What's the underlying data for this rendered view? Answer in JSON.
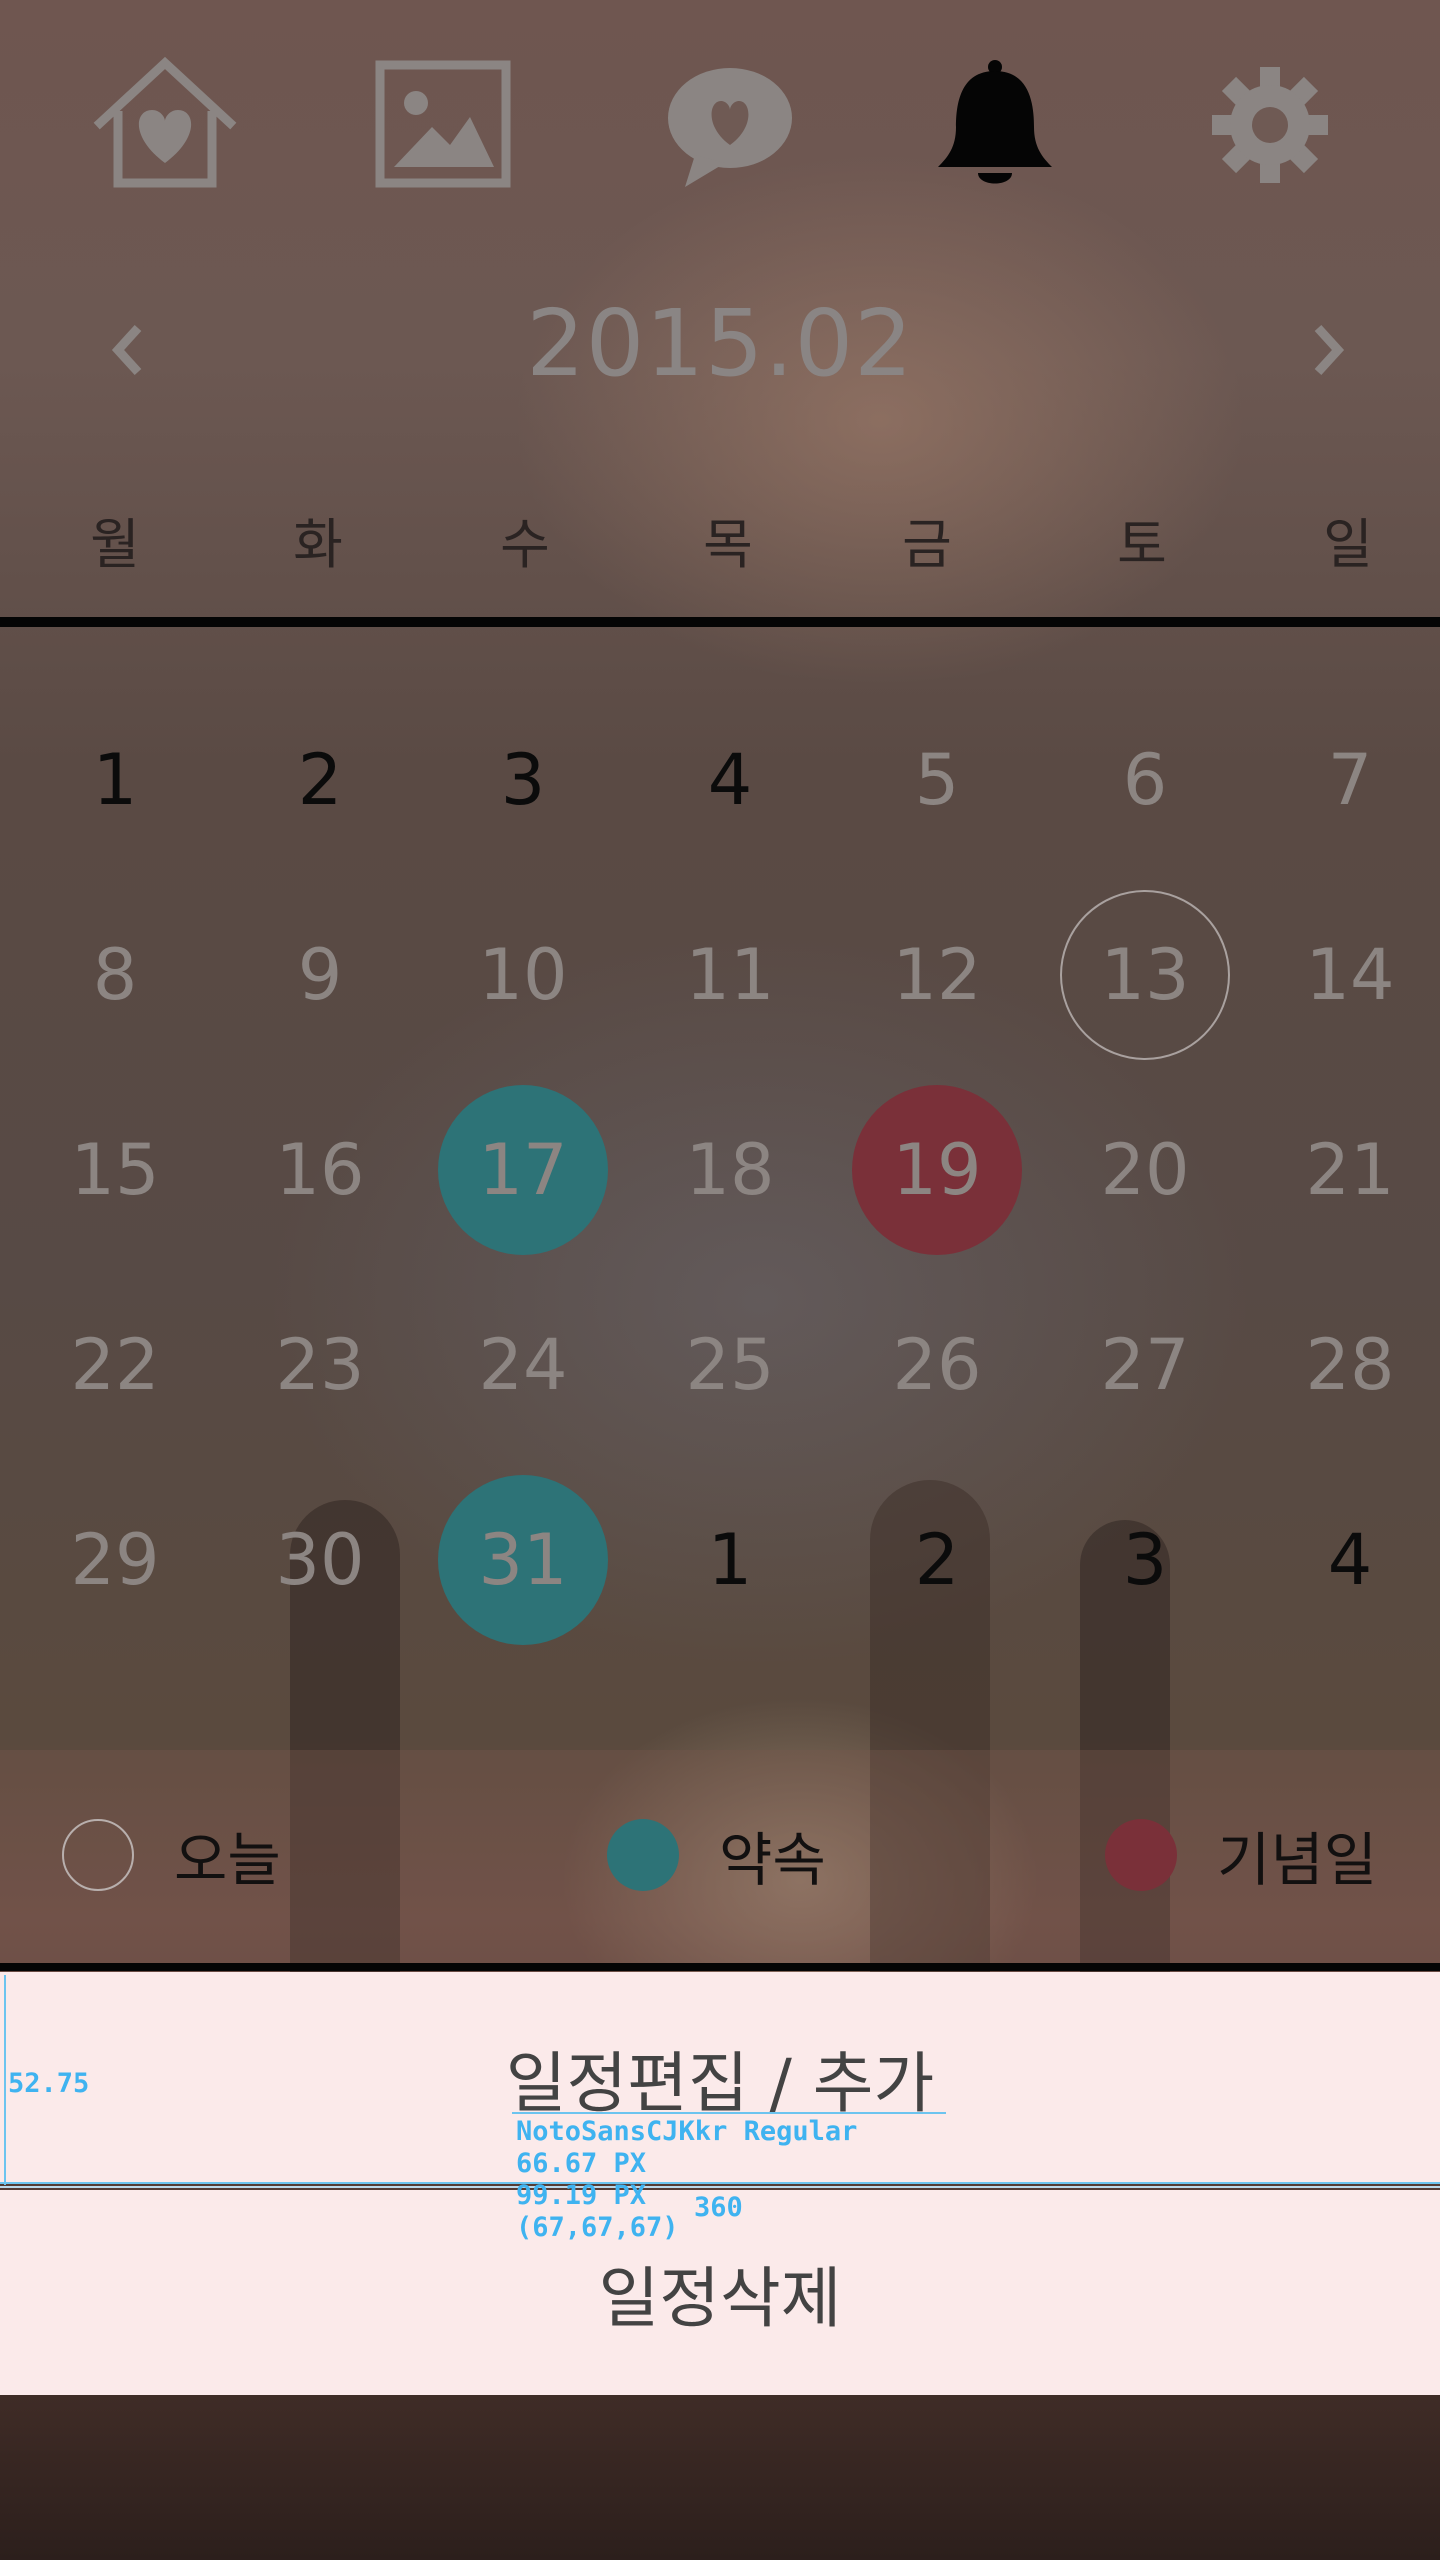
{
  "colors": {
    "appointment": "#2d7377",
    "anniversary": "#7a3039",
    "today_ring": "#a9a19f",
    "button_bg": "#fbeaea",
    "button_text": "#434343",
    "annotation": "#3fb3f0"
  },
  "nav": {
    "icons": [
      {
        "name": "home-heart-icon",
        "active": false
      },
      {
        "name": "image-icon",
        "active": false
      },
      {
        "name": "chat-heart-icon",
        "active": false
      },
      {
        "name": "bell-icon",
        "active": true
      },
      {
        "name": "gear-icon",
        "active": false
      }
    ]
  },
  "header": {
    "month": "2015.02",
    "prev_icon": "chevron-left-icon",
    "next_icon": "chevron-right-icon"
  },
  "weekdays": [
    "월",
    "화",
    "수",
    "목",
    "금",
    "토",
    "일"
  ],
  "calendar": {
    "weeks": [
      [
        {
          "d": "1",
          "style": "dark"
        },
        {
          "d": "2",
          "style": "dark"
        },
        {
          "d": "3",
          "style": "dark"
        },
        {
          "d": "4",
          "style": "dark"
        },
        {
          "d": "5",
          "style": "muted"
        },
        {
          "d": "6",
          "style": "muted"
        },
        {
          "d": "7",
          "style": "muted"
        }
      ],
      [
        {
          "d": "8",
          "style": "muted"
        },
        {
          "d": "9",
          "style": "muted"
        },
        {
          "d": "10",
          "style": "muted"
        },
        {
          "d": "11",
          "style": "muted"
        },
        {
          "d": "12",
          "style": "muted"
        },
        {
          "d": "13",
          "style": "today"
        },
        {
          "d": "14",
          "style": "muted"
        }
      ],
      [
        {
          "d": "15",
          "style": "muted"
        },
        {
          "d": "16",
          "style": "muted"
        },
        {
          "d": "17",
          "style": "appointment"
        },
        {
          "d": "18",
          "style": "muted"
        },
        {
          "d": "19",
          "style": "anniversary"
        },
        {
          "d": "20",
          "style": "muted"
        },
        {
          "d": "21",
          "style": "muted"
        }
      ],
      [
        {
          "d": "22",
          "style": "muted"
        },
        {
          "d": "23",
          "style": "muted"
        },
        {
          "d": "24",
          "style": "muted"
        },
        {
          "d": "25",
          "style": "muted"
        },
        {
          "d": "26",
          "style": "muted"
        },
        {
          "d": "27",
          "style": "muted"
        },
        {
          "d": "28",
          "style": "muted"
        }
      ],
      [
        {
          "d": "29",
          "style": "muted"
        },
        {
          "d": "30",
          "style": "muted"
        },
        {
          "d": "31",
          "style": "appointment"
        },
        {
          "d": "1",
          "style": "dark"
        },
        {
          "d": "2",
          "style": "dark"
        },
        {
          "d": "3",
          "style": "dark"
        },
        {
          "d": "4",
          "style": "dark"
        }
      ]
    ]
  },
  "legend": {
    "today": "오늘",
    "appointment": "약속",
    "anniversary": "기념일"
  },
  "actions": {
    "edit_add": "일정편집 / 추가",
    "delete": "일정삭제"
  },
  "annotations": {
    "height_value": "52.75",
    "font_name": "NotoSansCJKkr Regular",
    "font_size": "66.67 PX",
    "line_size": "99.19 PX",
    "color_rgb": "(67,67,67)",
    "width_value": "360"
  }
}
